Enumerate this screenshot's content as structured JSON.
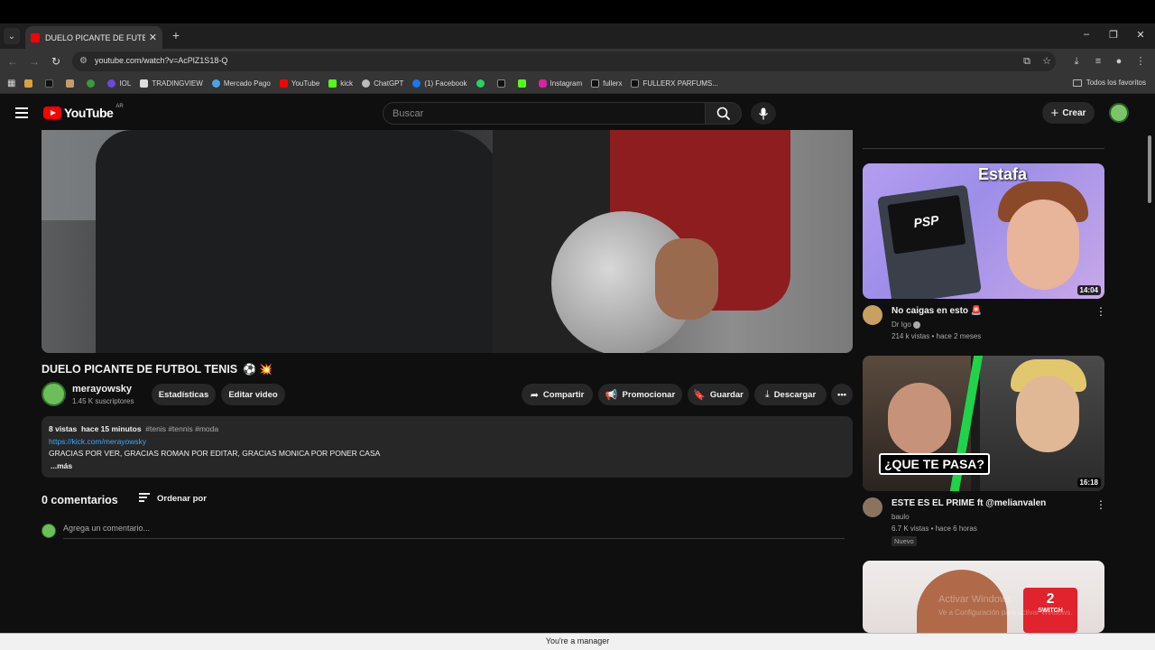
{
  "browser": {
    "tab_title": "DUELO PICANTE DE FUTBOL TE",
    "url": "youtube.com/watch?v=AcPlZ1S18-Q",
    "bookmarks": [
      "IOL",
      "TRADINGVIEW",
      "Mercado Pago",
      "YouTube",
      "kick",
      "ChatGPT",
      "(1) Facebook",
      "Instagram",
      "fullerx",
      "FULLERX PARFUMS..."
    ],
    "all_bookmarks": "Todos los favoritos"
  },
  "header": {
    "logo": "YouTube",
    "country": "AR",
    "search_placeholder": "Buscar",
    "create_label": "Crear"
  },
  "video": {
    "title": "DUELO PICANTE DE FUTBOL TENIS",
    "title_emojis": "⚽ 💥",
    "channel": "merayowsky",
    "subscribers": "1.45 K suscriptores",
    "actions": {
      "stats": "Estadísticas",
      "edit": "Editar video",
      "share": "Compartir",
      "promote": "Promocionar",
      "save": "Guardar",
      "download": "Descargar"
    }
  },
  "description": {
    "views": "8 vistas",
    "time": "hace 15 minutos",
    "tags": "#tenis #tennis #moda",
    "link": "https://kick.com/merayowsky",
    "body": "GRACIAS POR VER, GRACIAS ROMAN POR EDITAR, GRACIAS MONICA POR PONER CASA",
    "more": "...más"
  },
  "comments": {
    "count": "0 comentarios",
    "sort_label": "Ordenar por",
    "input_placeholder": "Agrega un comentario..."
  },
  "recommendations": [
    {
      "thumb_text": "Estafa",
      "duration": "14:04",
      "title": "No caigas en esto",
      "title_emoji": "🚨",
      "channel": "Dr Igo",
      "meta": "214 k vistas • hace 2 meses"
    },
    {
      "thumb_text": "¿QUE TE PASA?",
      "duration": "16:18",
      "title": "ESTE ES EL PRIME ft @melianvalen",
      "channel": "baulo",
      "meta": "6.7 K vistas • hace 6 horas",
      "badge": "Nuevo"
    },
    {
      "thumb_text": "2",
      "thumb_subtext": "SWITCH"
    }
  ],
  "banner": "You're a manager",
  "watermark": "Activar Windows",
  "watermark_sub": "Ve a Configuración para activar Windows."
}
